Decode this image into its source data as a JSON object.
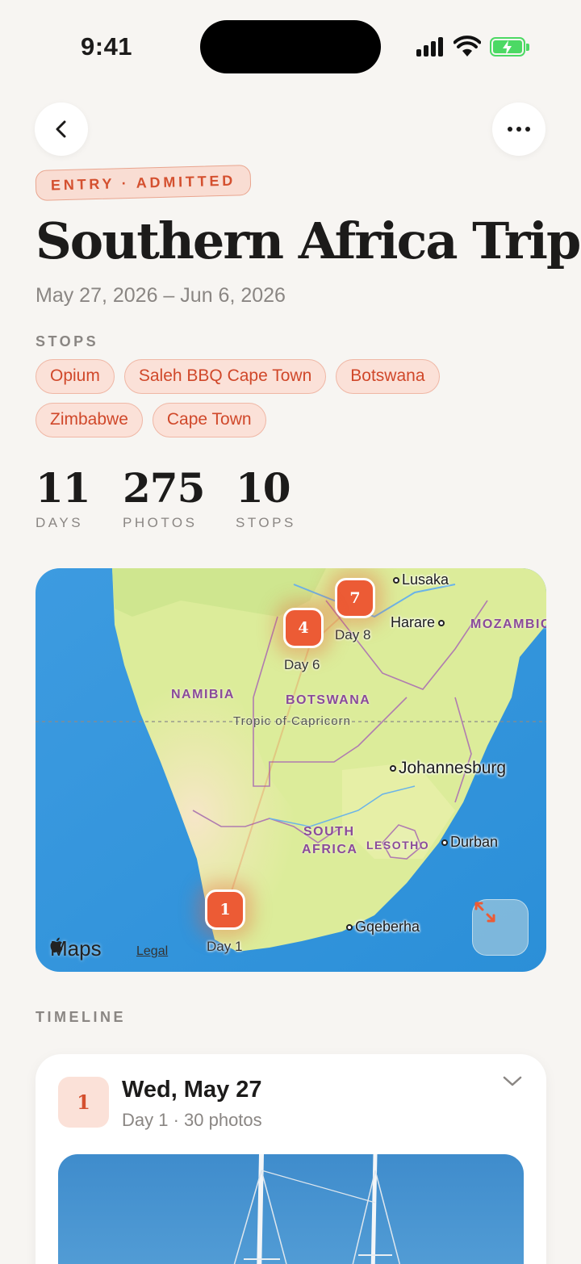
{
  "status_bar": {
    "time": "9:41"
  },
  "header": {
    "badge": "ENTRY · ADMITTED",
    "title": "Southern Africa Trip",
    "dates": "May 27, 2026 – Jun 6, 2026"
  },
  "stops": {
    "label": "STOPS",
    "items": [
      "Opium",
      "Saleh BBQ Cape Town",
      "Botswana",
      "Zimbabwe",
      "Cape Town"
    ]
  },
  "stats": [
    {
      "value": "11",
      "label": "DAYS"
    },
    {
      "value": "275",
      "label": "PHOTOS"
    },
    {
      "value": "10",
      "label": "STOPS"
    }
  ],
  "map": {
    "pins": [
      {
        "number": "1",
        "label": "Day 1"
      },
      {
        "number": "4",
        "label": "Day 6"
      },
      {
        "number": "7",
        "label": "Day 8"
      }
    ],
    "cities": [
      "Lusaka",
      "Harare",
      "Johannesburg",
      "Durban",
      "Gqeberha"
    ],
    "countries": [
      "NAMIBIA",
      "BOTSWANA",
      "SOUTH",
      "AFRICA",
      "LESOTHO",
      "MOZAMBIC"
    ],
    "tropic": "Tropic of Capricorn",
    "attribution": "Maps",
    "legal": "Legal"
  },
  "timeline": {
    "label": "TIMELINE",
    "days": [
      {
        "number": "1",
        "date": "Wed, May 27",
        "summary": "Day 1 · 30 photos"
      }
    ]
  },
  "colors": {
    "accent": "#ec5b35",
    "accent_soft": "#fbe1d8",
    "background": "#f7f5f2"
  }
}
